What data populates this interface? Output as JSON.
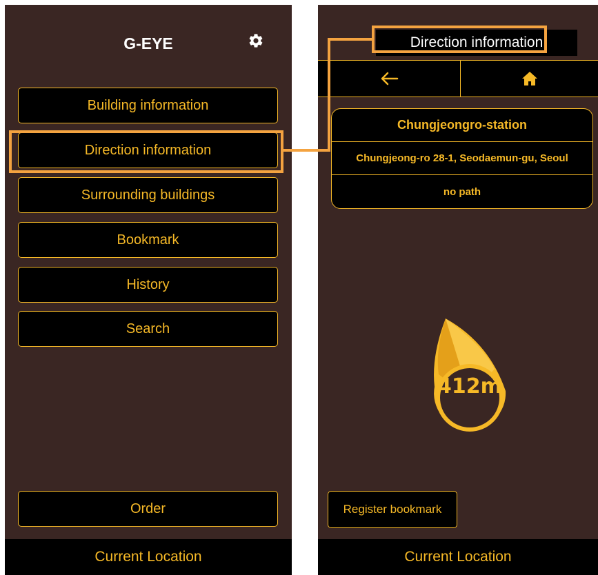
{
  "left_screen": {
    "app_title": "G-EYE",
    "menu": [
      {
        "label": "Building information"
      },
      {
        "label": "Direction information"
      },
      {
        "label": "Surrounding buildings"
      },
      {
        "label": "Bookmark"
      },
      {
        "label": "History"
      },
      {
        "label": "Search"
      }
    ],
    "order_label": "Order",
    "current_location_label": "Current Location",
    "icons": {
      "settings": "gear-icon"
    }
  },
  "right_screen": {
    "title": "Direction information",
    "nav": {
      "back_icon": "arrow-left-icon",
      "home_icon": "home-icon"
    },
    "destination": {
      "name": "Chungjeongro-station",
      "address": "Chungjeong-ro 28-1, Seodaemun-gu, Seoul",
      "path": "no path"
    },
    "distance": "412m",
    "register_bookmark_label": "Register bookmark",
    "current_location_label": "Current Location"
  },
  "colors": {
    "background": "#3a2623",
    "accent": "#f6b927",
    "highlight": "#f4a340",
    "panel": "#000000"
  }
}
